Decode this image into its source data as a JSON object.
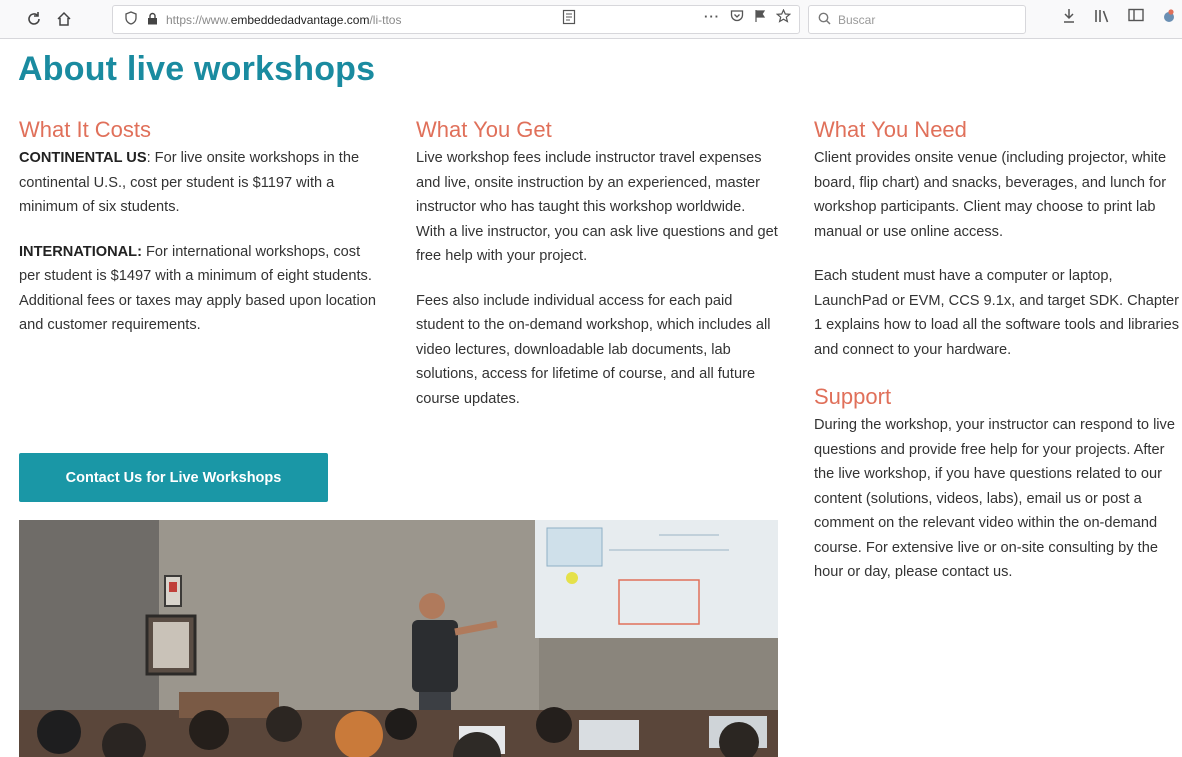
{
  "browser": {
    "url_prefix": "https://www.",
    "url_host": "embeddedadvantage.com",
    "url_path": "/li-ttos",
    "search_placeholder": "Buscar"
  },
  "page": {
    "title": "About live workshops",
    "costs": {
      "heading": "What It Costs",
      "p1_label": "CONTINENTAL US",
      "p1_text": ": For live onsite workshops in the continental U.S., cost per student is $1197 with a minimum of six students.",
      "p2_label": "INTERNATIONAL:",
      "p2_text": " For international workshops, cost per student is $1497 with a minimum of eight students. Additional fees or taxes may apply based upon location and customer requirements.",
      "button": "Contact Us for Live Workshops"
    },
    "get": {
      "heading": "What You Get",
      "p1": "Live workshop fees include instructor travel expenses and live, onsite instruction by an experienced, master instructor who has taught this workshop worldwide. With a live instructor, you can ask live questions and get free help with your project.",
      "p2": "Fees also include individual access for each paid student to the on-demand workshop, which includes all video lectures, downloadable lab documents, lab solutions, access for lifetime of course, and all future course updates."
    },
    "need": {
      "heading": "What You Need",
      "p1": "Client provides onsite venue (including projector, white board, flip chart) and snacks, beverages, and lunch for workshop participants. Client may choose to print lab manual or use online access.",
      "p2": "Each student must have a computer or laptop, LaunchPad or EVM, CCS 9.1x, and target SDK. Chapter 1 explains how to load all the software tools and libraries and connect to your hardware."
    },
    "support": {
      "heading": "Support",
      "p1": "During the workshop, your instructor can respond to live questions and provide free help for your projects. After the live workshop, if you have questions related to our content (solutions, videos, labs), email us or post a comment on the relevant video within the on-demand course. For extensive live or on-site consulting by the hour or day, please contact us."
    }
  },
  "colors": {
    "title": "#1a8ba0",
    "heading": "#e0705a",
    "button": "#1a97a6"
  },
  "icons": [
    "reload-icon",
    "home-icon",
    "shield-icon",
    "lock-icon",
    "reader-icon",
    "more-icon",
    "pocket-icon",
    "flag-icon",
    "bookmark-star-icon",
    "search-icon",
    "download-icon",
    "library-icon",
    "sidebar-icon",
    "extension-icon"
  ]
}
